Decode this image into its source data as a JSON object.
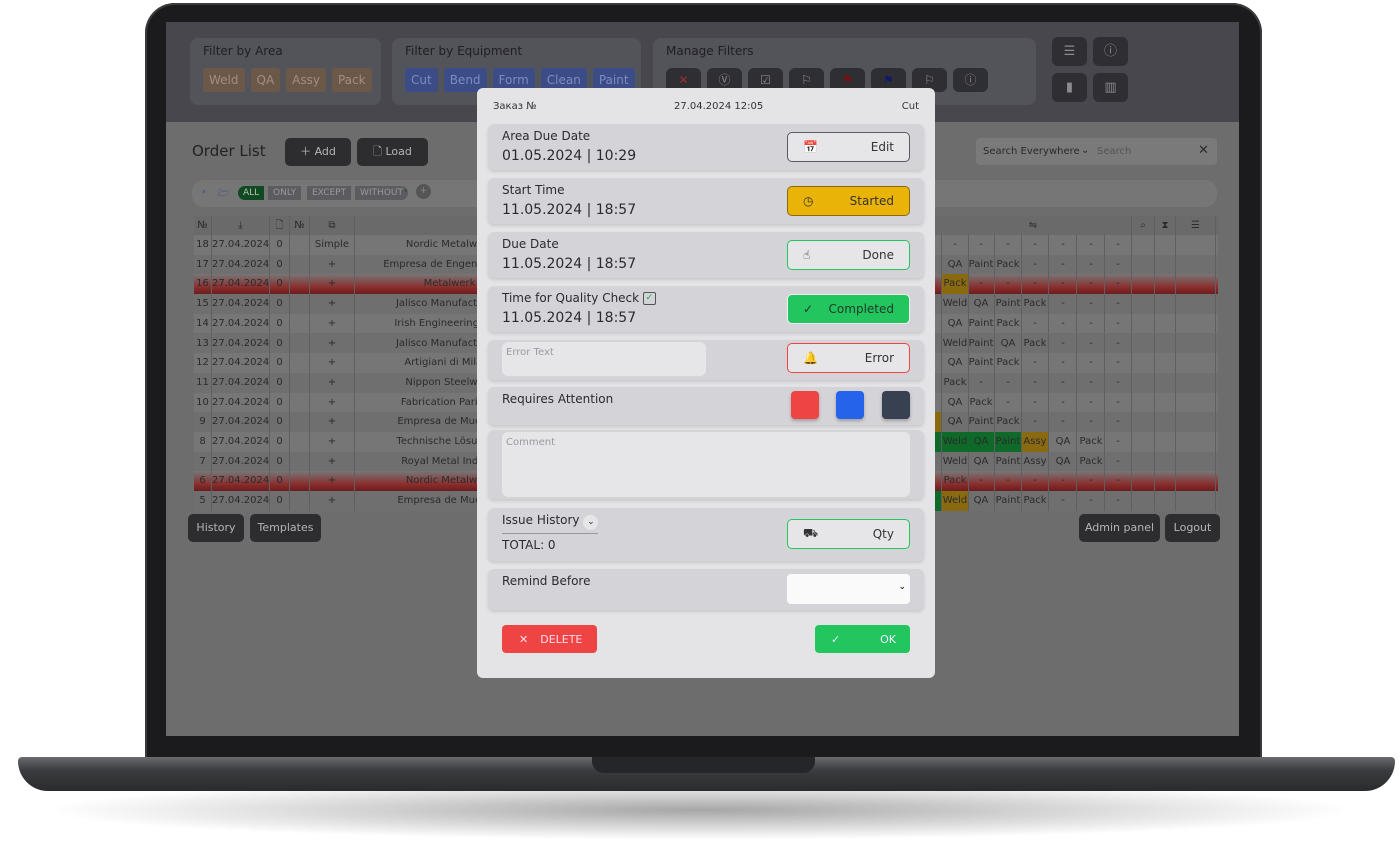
{
  "header": {
    "area_filter": {
      "title": "Filter by Area",
      "chips": [
        "Weld",
        "QA",
        "Assy",
        "Pack"
      ]
    },
    "equipment_filter": {
      "title": "Filter by Equipment",
      "chips": [
        "Cut",
        "Bend",
        "Form",
        "Clean",
        "Paint"
      ]
    },
    "manage_filters": {
      "title": "Manage Filters",
      "buttons": [
        "close-icon",
        "eye-v-icon",
        "square-v-icon",
        "flag-icon",
        "flag-red-icon",
        "flag-blue-icon",
        "flag-icon",
        "alert-circle-icon"
      ]
    },
    "icon_buttons": [
      "sliders-icon",
      "info-icon",
      "bar-chart-icon",
      "column-chart-icon"
    ]
  },
  "order_list": {
    "title": "Order List",
    "add_label": "Add",
    "load_label": "Load",
    "search_scope": "Search Everywhere",
    "search_placeholder": "Search",
    "filter_modes": [
      "ALL",
      "ONLY",
      "EXCEPT",
      "WITHOUT"
    ],
    "rows": [
      {
        "no": "18",
        "date": "27.04.2024",
        "count": "0",
        "type": "Simple",
        "customer": "Nordic Metalwork",
        "stages": [
          "-",
          "-",
          "-",
          "-",
          "-",
          "-",
          "-"
        ],
        "red": false
      },
      {
        "no": "17",
        "date": "27.04.2024",
        "count": "0",
        "type": "+",
        "customer": "Empresa de Engenharia Ri",
        "stages": [
          "QA",
          "Paint",
          "Pack",
          "-",
          "-",
          "-",
          "-"
        ],
        "red": false
      },
      {
        "no": "16",
        "date": "27.04.2024",
        "count": "0",
        "type": "+",
        "customer": "Metalwerk",
        "stages": [
          "Pack",
          "-",
          "-",
          "-",
          "-",
          "-",
          "-"
        ],
        "red": true
      },
      {
        "no": "15",
        "date": "27.04.2024",
        "count": "0",
        "type": "+",
        "customer": "Jalisco Manufacturing",
        "stages": [
          "Weld",
          "QA",
          "Paint",
          "Pack",
          "-",
          "-",
          "-"
        ],
        "red": false
      },
      {
        "no": "14",
        "date": "27.04.2024",
        "count": "0",
        "type": "+",
        "customer": "Irish Engineering Serv",
        "stages": [
          "QA",
          "Paint",
          "Pack",
          "-",
          "-",
          "-",
          "-"
        ],
        "red": false
      },
      {
        "no": "13",
        "date": "27.04.2024",
        "count": "0",
        "type": "+",
        "customer": "Jalisco Manufacturing",
        "stages": [
          "Weld",
          "Paint",
          "QA",
          "Pack",
          "-",
          "-",
          "-"
        ],
        "red": false
      },
      {
        "no": "12",
        "date": "27.04.2024",
        "count": "0",
        "type": "+",
        "customer": "Artigiani di Milano",
        "stages": [
          "QA",
          "Paint",
          "Pack",
          "-",
          "-",
          "-",
          "-"
        ],
        "red": false
      },
      {
        "no": "11",
        "date": "27.04.2024",
        "count": "0",
        "type": "+",
        "customer": "Nippon Steelwork",
        "stages": [
          "Pack",
          "-",
          "-",
          "-",
          "-",
          "-",
          "-"
        ],
        "red": false
      },
      {
        "no": "10",
        "date": "27.04.2024",
        "count": "0",
        "type": "+",
        "customer": "Fabrication Parisien",
        "stages": [
          "QA",
          "Pack",
          "-",
          "-",
          "-",
          "-",
          "-"
        ],
        "red": false
      },
      {
        "no": "9",
        "date": "27.04.2024",
        "count": "0",
        "type": "+",
        "customer": "Empresa de Muebles",
        "stages": [
          "QA",
          "Paint",
          "Pack",
          "-",
          "-",
          "-",
          "-"
        ],
        "red": false
      },
      {
        "no": "8",
        "date": "27.04.2024",
        "count": "0",
        "type": "+",
        "customer": "Technische Lösungen",
        "stages": [
          "Weld",
          "QA",
          "Paint",
          "Assy",
          "QA",
          "Pack",
          "-"
        ],
        "red": false
      },
      {
        "no": "7",
        "date": "27.04.2024",
        "count": "0",
        "type": "+",
        "customer": "Royal Metal Industr",
        "stages": [
          "Weld",
          "QA",
          "Paint",
          "Assy",
          "QA",
          "Pack",
          "-"
        ],
        "red": false
      },
      {
        "no": "6",
        "date": "27.04.2024",
        "count": "0",
        "type": "+",
        "customer": "Nordic Metalwork",
        "stages": [
          "Pack",
          "-",
          "-",
          "-",
          "-",
          "-",
          "-"
        ],
        "red": true
      },
      {
        "no": "5",
        "date": "27.04.2024",
        "count": "0",
        "type": "+",
        "customer": "Empresa de Muebles",
        "stages": [
          "Weld",
          "QA",
          "Paint",
          "Pack",
          "-",
          "-",
          "-"
        ],
        "red": false
      }
    ],
    "footer": {
      "history": "History",
      "templates": "Templates",
      "admin": "Admin panel",
      "logout": "Logout"
    }
  },
  "modal": {
    "order_label": "Заказ №",
    "datetime": "27.04.2024 12:05",
    "equipment": "Cut",
    "area_due": {
      "label": "Area Due Date",
      "value": "01.05.2024 | 10:29",
      "button": "Edit"
    },
    "start": {
      "label": "Start Time",
      "value": "11.05.2024 | 18:57",
      "button": "Started"
    },
    "due": {
      "label": "Due Date",
      "value": "11.05.2024 | 18:57",
      "button": "Done"
    },
    "qc": {
      "label": "Time for Quality Check",
      "value": "11.05.2024 | 18:57",
      "button": "Completed",
      "checked": true
    },
    "error": {
      "placeholder": "Error Text",
      "button": "Error"
    },
    "attention": {
      "label": "Requires Attention",
      "colors": [
        "#ef4444",
        "#2563eb",
        "#374151"
      ]
    },
    "comment_placeholder": "Comment",
    "issue_history": {
      "label": "Issue History",
      "total": "TOTAL: 0",
      "button": "Qty"
    },
    "remind_before": {
      "label": "Remind Before",
      "value": ""
    },
    "delete_label": "DELETE",
    "ok_label": "OK"
  },
  "colors": {
    "started": "#eab308",
    "completed": "#22c55e",
    "error": "#ef4444",
    "delete": "#ef4444",
    "ok": "#22c55e"
  }
}
